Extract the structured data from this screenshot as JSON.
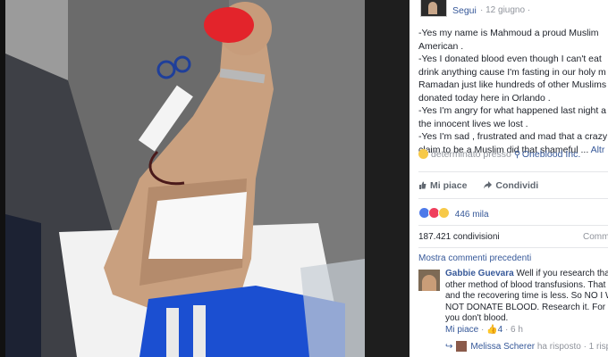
{
  "photo": {
    "alt_subject": "blood-donation-arm-photo"
  },
  "post": {
    "follow_label": "Segui",
    "date": "· 12 giugno ·",
    "lines": [
      "-Yes my name is Mahmoud a proud Muslim",
      "American .",
      "-Yes I donated blood even though I can't eat",
      "drink anything cause I'm fasting in our holy m",
      "Ramadan just like hundreds of other Muslims",
      "donated today here in Orlando .",
      "-Yes I'm angry for what happened last night a",
      "the innocent lives we lost .",
      "-Yes I'm sad , frustrated and mad that a crazy",
      "claim to be a Muslim did that shameful ..."
    ],
    "more_label": "Altr",
    "feeling_prefix": "determinato presso",
    "location": "Oneblood Inc."
  },
  "actions": {
    "like": "Mi piace",
    "share": "Condividi"
  },
  "stats": {
    "reactions_count": "446 mila",
    "shares": "187.421 condivisioni",
    "comments_label": "Comm"
  },
  "comments": {
    "show_previous": "Mostra commenti precedenti",
    "first": {
      "author": "Gabbie Guevara",
      "lines": [
        "Well if you research that the",
        "other method of blood transfusions. That cost",
        "and the recovering time is less. So NO I WON",
        "NOT DONATE BLOOD. Research it. For all th",
        "you don't blood."
      ],
      "like_label": "Mi piace",
      "like_count": "4",
      "time": "· 6 h"
    },
    "reply": {
      "author": "Melissa Scherer",
      "action": "ha risposto",
      "extra": "· 1 rispost"
    }
  },
  "colors": {
    "link": "#365899",
    "meta": "#90949c",
    "text": "#1d2129"
  }
}
